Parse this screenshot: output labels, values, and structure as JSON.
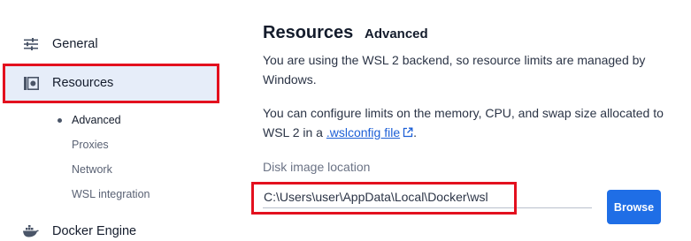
{
  "sidebar": {
    "items": [
      {
        "label": "General",
        "icon": "sliders-icon"
      },
      {
        "label": "Resources",
        "icon": "resources-icon",
        "selected": true
      },
      {
        "label": "Docker Engine",
        "icon": "whale-icon"
      }
    ],
    "subitems": [
      {
        "label": "Advanced",
        "active": true
      },
      {
        "label": "Proxies"
      },
      {
        "label": "Network"
      },
      {
        "label": "WSL integration"
      }
    ]
  },
  "main": {
    "title": "Resources",
    "subtitle": "Advanced",
    "para1": "You are using the WSL 2 backend, so resource limits are managed by Windows.",
    "para2_prefix": "You can configure limits on the memory, CPU, and swap size allocated to WSL 2 in a ",
    "para2_link": ".wslconfig file",
    "para2_suffix": ".",
    "disk_label": "Disk image location",
    "disk_path": "C:\\Users\\user\\AppData\\Local\\Docker\\wsl",
    "browse_label": "Browse"
  },
  "colors": {
    "accent": "#1f6ee6",
    "selected_bg": "#e6edf9",
    "annotation": "#e3101e"
  }
}
